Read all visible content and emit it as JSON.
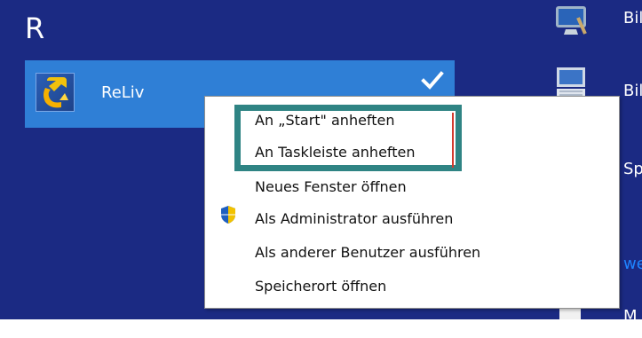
{
  "start_screen": {
    "group_letter": "R",
    "app_tile": {
      "name": "ReLiv",
      "icon": "reliv-app-icon",
      "selected": true
    },
    "right_column": [
      {
        "label": "Bil",
        "icon": "monitor-tools-icon"
      },
      {
        "label": "Bil",
        "icon": "keyboard-icon"
      },
      {
        "label": "Sp"
      },
      {
        "label": "we"
      },
      {
        "label": "M"
      }
    ]
  },
  "context_menu": {
    "items": [
      {
        "label": "An „Start\" anheften",
        "icon": ""
      },
      {
        "label": "An Taskleiste anheften",
        "icon": ""
      },
      {
        "label": "Neues Fenster öffnen",
        "icon": ""
      },
      {
        "label": "Als Administrator ausführen",
        "icon": "uac-shield-icon"
      },
      {
        "label": "Als anderer Benutzer ausführen",
        "icon": ""
      },
      {
        "label": "Speicherort öffnen",
        "icon": ""
      }
    ]
  },
  "colors": {
    "background": "#1b2a83",
    "tile_selected": "#2f7fd6",
    "highlight_box": "#2f8484",
    "accent_red": "#d43a2f",
    "link_blue": "#1e84ff"
  }
}
